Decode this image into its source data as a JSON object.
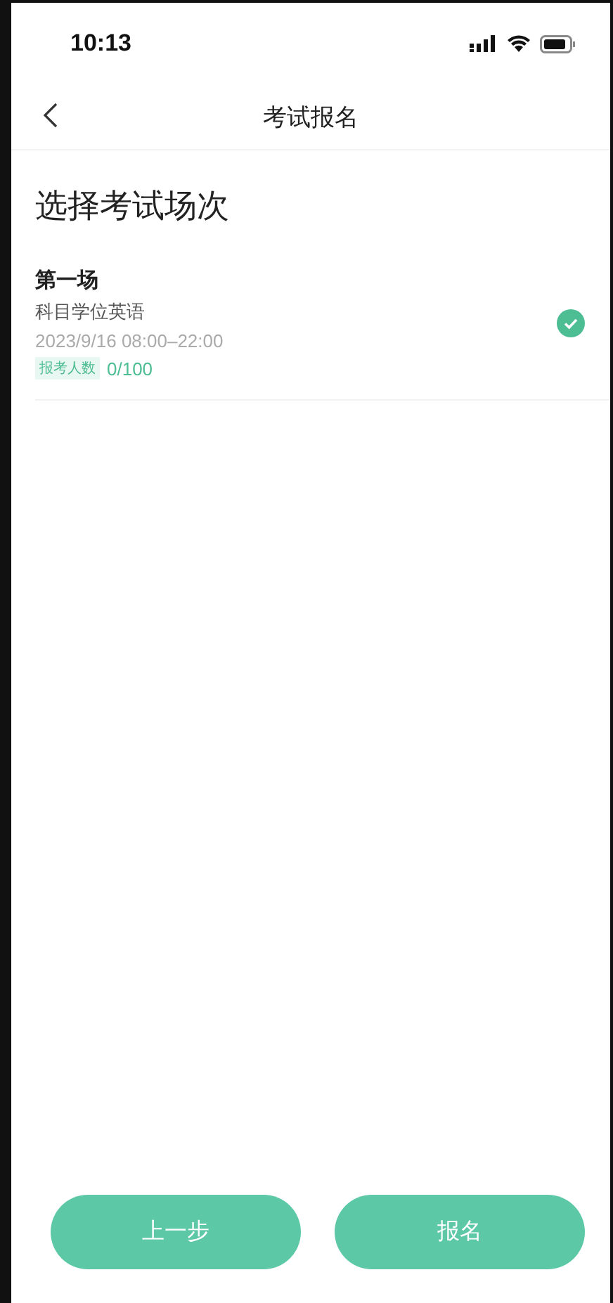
{
  "status_bar": {
    "time": "10:13"
  },
  "nav": {
    "title": "考试报名"
  },
  "heading": "选择考试场次",
  "sessions": [
    {
      "name": "第一场",
      "subject": "科目学位英语",
      "time": "2023/9/16 08:00–22:00",
      "tag": "报考人数",
      "count": "0/100",
      "selected": true
    }
  ],
  "buttons": [
    {
      "label": "上一步"
    },
    {
      "label": "报名"
    }
  ]
}
